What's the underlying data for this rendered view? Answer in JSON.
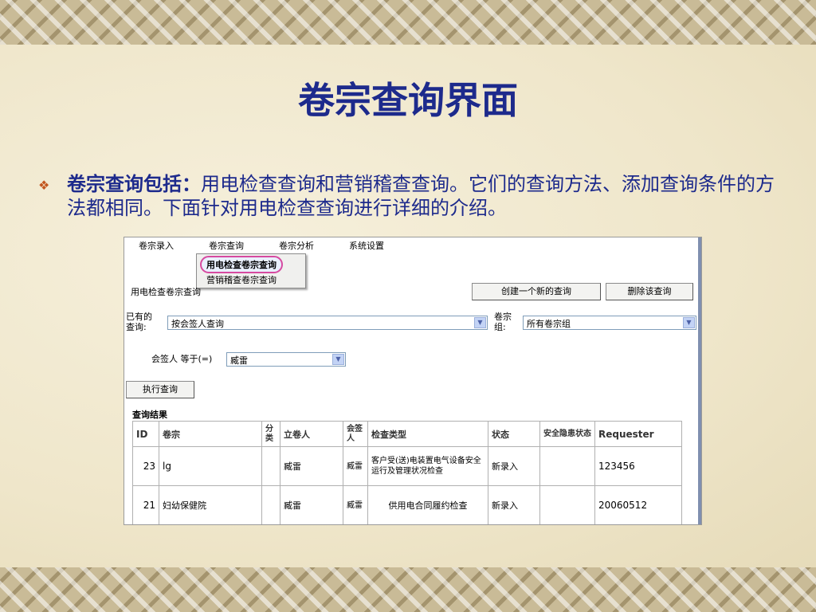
{
  "slide": {
    "title": "卷宗查询界面",
    "bullet_lead": "卷宗查询包括：",
    "bullet_text": "用电检查查询和营销稽查查询。它们的查询方法、添加查询条件的方法都相同。下面针对用电检查查询进行详细的介绍。"
  },
  "app": {
    "menu": [
      "卷宗录入",
      "卷宗查询",
      "卷宗分析",
      "系统设置"
    ],
    "dropdown": [
      "用电检查卷宗查询",
      "营销稽查卷宗查询"
    ],
    "page_label": "用电检查卷宗查询",
    "create_button": "创建一个新的查询",
    "delete_button": "删除该查询",
    "existing_query_label": "已有的查询:",
    "existing_query_value": "按会签人查询",
    "group_label": "卷宗组:",
    "group_value": "所有卷宗组",
    "condition_label": "会签人 等于(=)",
    "condition_value": "臧雷",
    "execute_button": "执行查询",
    "results_title": "查询结果",
    "columns": [
      "ID",
      "卷宗",
      "分类",
      "立卷人",
      "会签人",
      "检查类型",
      "状态",
      "安全隐患状态",
      "Requester"
    ],
    "rows": [
      [
        "23",
        "lg",
        "",
        "臧雷",
        "臧雷",
        "客户受(送)电装置电气设备安全运行及管理状况检查",
        "新录入",
        "",
        "123456"
      ],
      [
        "21",
        "妇幼保健院",
        "",
        "臧雷",
        "臧雷",
        "供用电合同履约检查",
        "新录入",
        "",
        "20060512"
      ]
    ]
  },
  "colors": {
    "title": "#1d2a8c",
    "bullet": "#c2561e",
    "highlight": "#d64aa0"
  }
}
